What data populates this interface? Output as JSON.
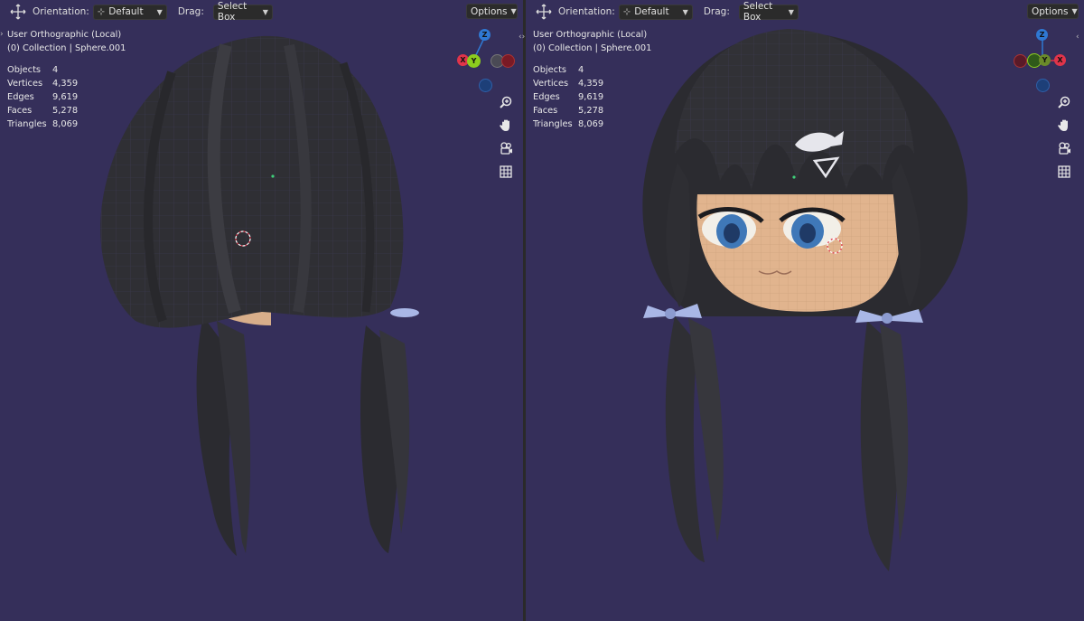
{
  "left_viewport": {
    "header": {
      "orientation_label": "Orientation:",
      "orientation_value": "Default",
      "drag_label": "Drag:",
      "drag_value": "Select Box",
      "options_label": "Options"
    },
    "view_name": "User Orthographic (Local)",
    "collection_info": "(0) Collection | Sphere.001",
    "stats": [
      {
        "label": "Objects",
        "value": "4"
      },
      {
        "label": "Vertices",
        "value": "4,359"
      },
      {
        "label": "Edges",
        "value": "9,619"
      },
      {
        "label": "Faces",
        "value": "5,278"
      },
      {
        "label": "Triangles",
        "value": "8,069"
      }
    ],
    "gizmo": {
      "z": "Z",
      "x": "X",
      "y": "Y"
    }
  },
  "right_viewport": {
    "header": {
      "orientation_label": "Orientation:",
      "orientation_value": "Default",
      "drag_label": "Drag:",
      "drag_value": "Select Box",
      "options_label": "Options"
    },
    "view_name": "User Orthographic (Local)",
    "collection_info": "(0) Collection | Sphere.001",
    "stats": [
      {
        "label": "Objects",
        "value": "4"
      },
      {
        "label": "Vertices",
        "value": "4,359"
      },
      {
        "label": "Edges",
        "value": "9,619"
      },
      {
        "label": "Faces",
        "value": "5,278"
      },
      {
        "label": "Triangles",
        "value": "8,069"
      }
    ],
    "gizmo": {
      "z": "Z",
      "x": "X",
      "y": "Y"
    }
  },
  "colors": {
    "viewport_bg": "#352f5a",
    "hair": "#2e2e33",
    "skin": "#e1b48e",
    "eye_blue": "#3f78b8",
    "ribbon": "#a9b7e6",
    "axis_x": "#e0344a",
    "axis_y": "#8ccc1e",
    "axis_z": "#2f78d2"
  },
  "nav_tools": [
    "zoom-icon",
    "hand-pan-icon",
    "camera-icon",
    "grid-icon"
  ]
}
